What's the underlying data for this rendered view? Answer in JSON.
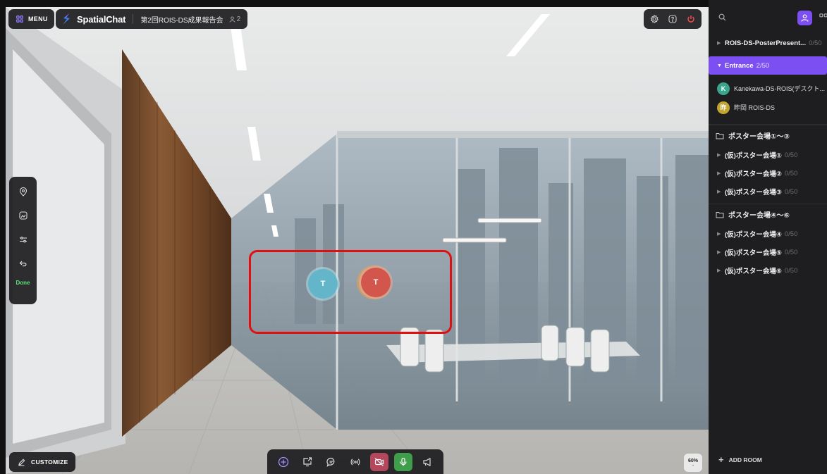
{
  "topbar": {
    "menu_label": "MENU",
    "logo_text": "SpatialChat",
    "space_name": "第2回ROIS-DS成果報告会",
    "participant_count": "2"
  },
  "toolstrip": {
    "done_label": "Done"
  },
  "avatars": [
    {
      "initial": "T",
      "color": "#63b6ca"
    },
    {
      "initial": "T",
      "color": "#d2564b"
    }
  ],
  "bottom": {
    "customize_label": "CUSTOMIZE",
    "zoom_level": "60%"
  },
  "sidebar": {
    "rooms_top": [
      {
        "name": "ROIS-DS-PosterPresent...",
        "count": "0/50"
      }
    ],
    "active_room": {
      "name": "Entrance",
      "count": "2/50"
    },
    "users": [
      {
        "badge": "K",
        "color": "#3aa58a",
        "name": "Kanekawa-DS-ROIS(デスクト..."
      },
      {
        "badge": "昨",
        "color": "#c2a52e",
        "name": "昨岡  ROIS-DS"
      }
    ],
    "folders": [
      {
        "name": "ポスター会場①〜③",
        "rooms": [
          {
            "name": "(仮)ポスター会場①",
            "count": "0/50"
          },
          {
            "name": "(仮)ポスター会場②",
            "count": "0/50"
          },
          {
            "name": "(仮)ポスター会場③",
            "count": "0/50"
          }
        ]
      },
      {
        "name": "ポスター会場④〜⑥",
        "rooms": [
          {
            "name": "(仮)ポスター会場④",
            "count": "0/50"
          },
          {
            "name": "(仮)ポスター会場⑤",
            "count": "0/50"
          },
          {
            "name": "(仮)ポスター会場⑥",
            "count": "0/50"
          }
        ]
      }
    ],
    "add_room_label": "ADD ROOM"
  },
  "colors": {
    "accent": "#7b4ff2",
    "mic_on": "#3f9e4c",
    "camera_off": "#b3475c",
    "highlight": "#e01010"
  }
}
